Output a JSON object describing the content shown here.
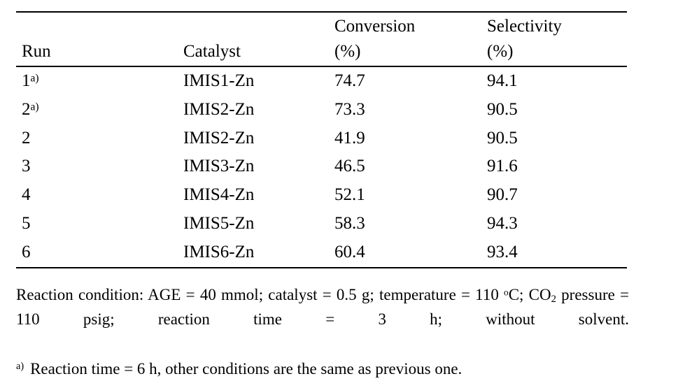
{
  "table": {
    "columns": [
      {
        "id": "run",
        "line1": "",
        "line2": "Run"
      },
      {
        "id": "catalyst",
        "line1": "",
        "line2": "Catalyst"
      },
      {
        "id": "conversion",
        "line1": "Conversion",
        "line2": "(%)"
      },
      {
        "id": "selectivity",
        "line1": "Selectivity",
        "line2": "(%)"
      }
    ],
    "rows": [
      {
        "run": "1",
        "run_note": "a)",
        "catalyst": "IMIS1-Zn",
        "conversion": "74.7",
        "selectivity": "94.1"
      },
      {
        "run": "2",
        "run_note": "a)",
        "catalyst": "IMIS2-Zn",
        "conversion": "73.3",
        "selectivity": "90.5"
      },
      {
        "run": "2",
        "run_note": "",
        "catalyst": "IMIS2-Zn",
        "conversion": "41.9",
        "selectivity": "90.5"
      },
      {
        "run": "3",
        "run_note": "",
        "catalyst": "IMIS3-Zn",
        "conversion": "46.5",
        "selectivity": "91.6"
      },
      {
        "run": "4",
        "run_note": "",
        "catalyst": "IMIS4-Zn",
        "conversion": "52.1",
        "selectivity": "90.7"
      },
      {
        "run": "5",
        "run_note": "",
        "catalyst": "IMIS5-Zn",
        "conversion": "58.3",
        "selectivity": "94.3"
      },
      {
        "run": "6",
        "run_note": "",
        "catalyst": "IMIS6-Zn",
        "conversion": "60.4",
        "selectivity": "93.4"
      }
    ]
  },
  "footnotes": {
    "condition_part1": "Reaction condition: AGE = 40 mmol; catalyst = 0.5 g; temperature = 110 ",
    "condition_degree": "o",
    "condition_part2": "C; CO",
    "condition_sub": "2",
    "condition_part3": " pressure = 110 psig; reaction time = 3 h; without solvent.",
    "marker_a": "a)",
    "note_a_text": "Reaction time = 6 h, other conditions are the same as previous one."
  },
  "colors": {
    "text": "#000000",
    "rule": "#000000",
    "background": "#ffffff"
  }
}
